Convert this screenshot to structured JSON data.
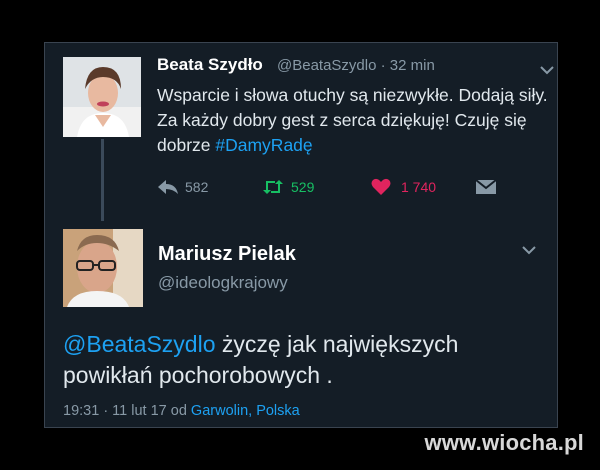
{
  "tweet1": {
    "name": "Beata Szydło",
    "handle": "@BeataSzydlo",
    "time": "· 32 min",
    "text_before": "Wsparcie i słowa otuchy są niezwykłe. Dodają siły. Za każdy dobry gest  z serca dziękuję! Czuję się dobrze ",
    "hashtag": "#DamyRadę",
    "actions": {
      "reply_count": "582",
      "retweet_count": "529",
      "like_count": "1 740"
    }
  },
  "tweet2": {
    "name": "Mariusz Pielak",
    "handle": "@ideologkrajowy",
    "mention": "@BeataSzydlo",
    "text_after": " życzę jak największych powikłań  pochorobowych .",
    "meta_prefix": "19:31 · 11 lut 17  od ",
    "place": "Garwolin, Polska"
  },
  "watermark": "www.wiocha.pl",
  "colors": {
    "background": "#141d26",
    "accent": "#1da1f2",
    "retweet": "#17bf63",
    "like": "#e0245e",
    "muted": "#8899a6"
  },
  "icons": {
    "reply": "reply-icon",
    "retweet": "retweet-icon",
    "like": "heart-icon",
    "dm": "direct-message-icon",
    "more": "chevron-down-icon"
  }
}
